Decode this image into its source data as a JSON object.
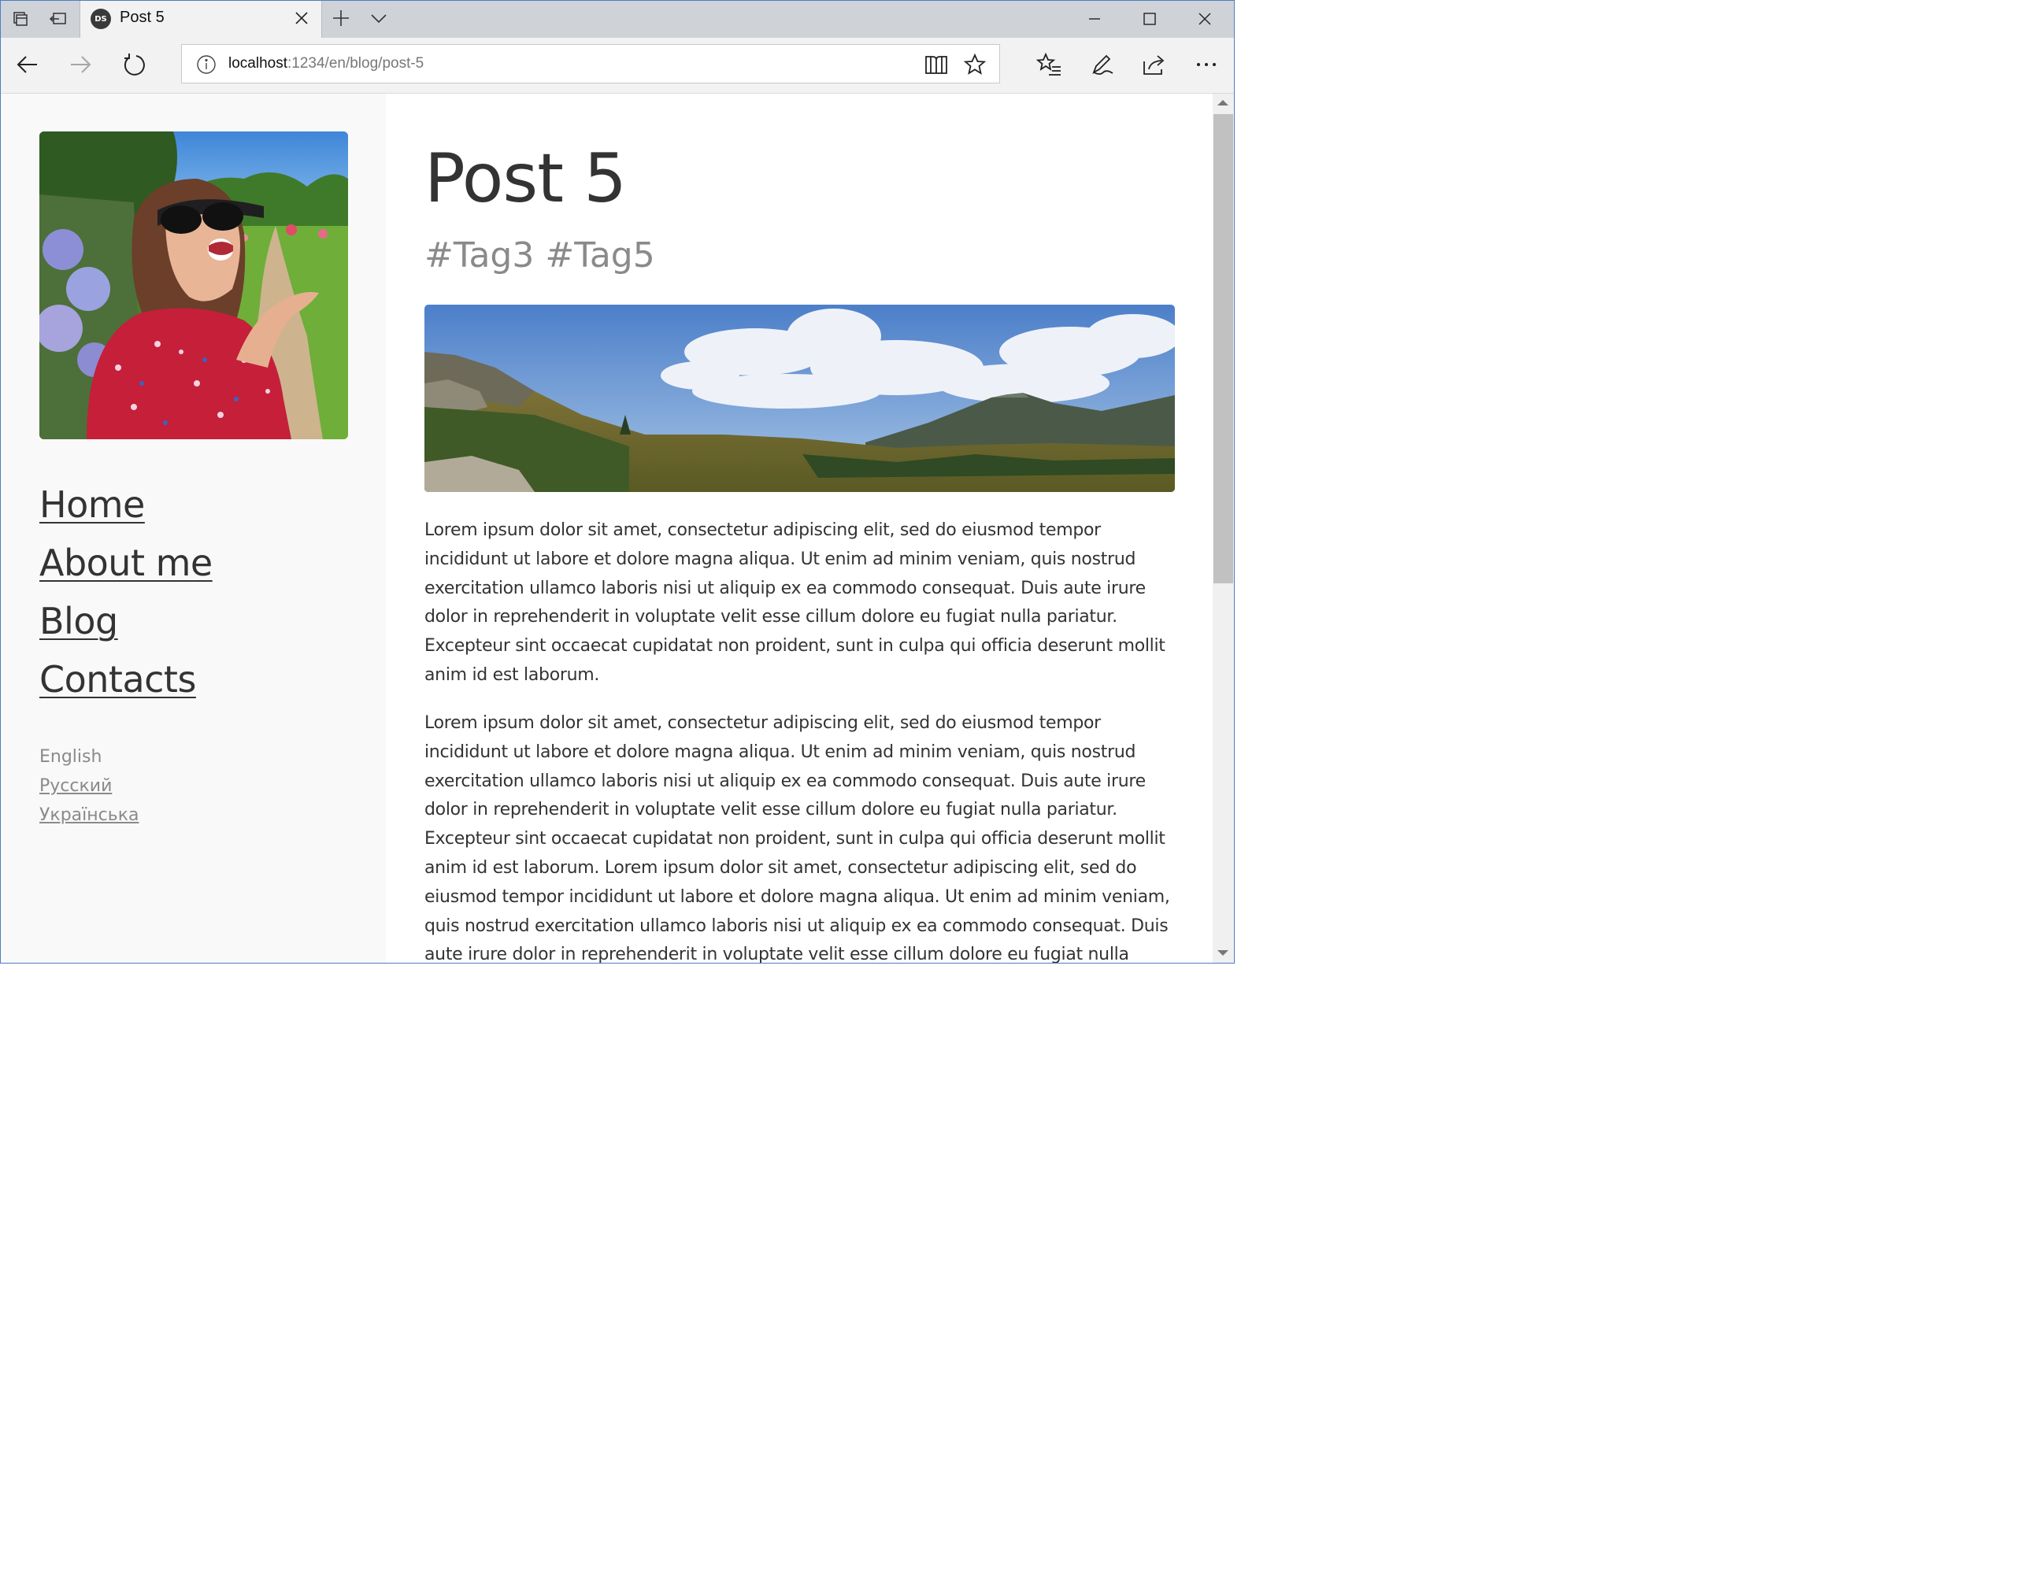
{
  "browser": {
    "tab_title": "Post 5",
    "favicon_text": "DS",
    "url_host": "localhost",
    "url_path": ":1234/en/blog/post-5"
  },
  "sidebar": {
    "menu": [
      {
        "label": "Home"
      },
      {
        "label": "About me"
      },
      {
        "label": "Blog"
      },
      {
        "label": "Contacts"
      }
    ],
    "languages": {
      "current": "English",
      "others": [
        "Русский",
        "Українська"
      ]
    }
  },
  "post": {
    "title": "Post 5",
    "tags": [
      "#Tag3",
      "#Tag5"
    ],
    "paragraphs": [
      "Lorem ipsum dolor sit amet, consectetur adipiscing elit, sed do eiusmod tempor incididunt ut labore et dolore magna aliqua. Ut enim ad minim veniam, quis nostrud exercitation ullamco laboris nisi ut aliquip ex ea commodo consequat. Duis aute irure dolor in reprehenderit in voluptate velit esse cillum dolore eu fugiat nulla pariatur. Excepteur sint occaecat cupidatat non proident, sunt in culpa qui officia deserunt mollit anim id est laborum.",
      "Lorem ipsum dolor sit amet, consectetur adipiscing elit, sed do eiusmod tempor incididunt ut labore et dolore magna aliqua. Ut enim ad minim veniam, quis nostrud exercitation ullamco laboris nisi ut aliquip ex ea commodo consequat. Duis aute irure dolor in reprehenderit in voluptate velit esse cillum dolore eu fugiat nulla pariatur. Excepteur sint occaecat cupidatat non proident, sunt in culpa qui officia deserunt mollit anim id est laborum. Lorem ipsum dolor sit amet, consectetur adipiscing elit, sed do eiusmod tempor incididunt ut labore et dolore magna aliqua. Ut enim ad minim veniam, quis nostrud exercitation ullamco laboris nisi ut aliquip ex ea commodo consequat. Duis aute irure dolor in reprehenderit in voluptate velit esse cillum dolore eu fugiat nulla pariatur."
    ]
  },
  "colors": {
    "window_border": "#4a7fc1",
    "tabbar_bg": "#cfd3d8",
    "sidebar_bg": "#f9f9f9",
    "text": "#333333",
    "muted": "#8a8a8a"
  }
}
